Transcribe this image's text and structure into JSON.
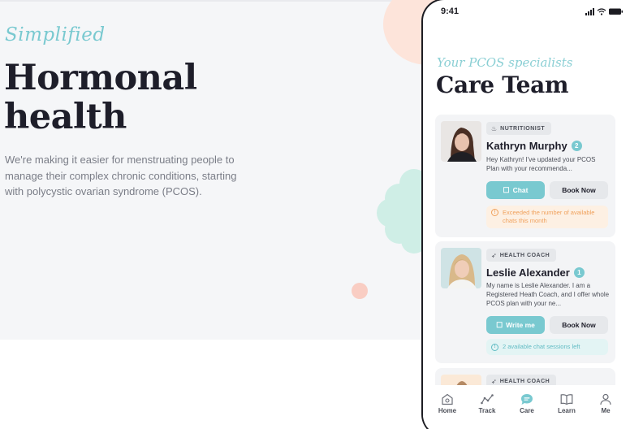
{
  "hero": {
    "eyebrow": "Simplified",
    "headline_line1": "Hormonal",
    "headline_line2": "health",
    "description": "We're making it easier for menstruating people to manage their complex chronic conditions, starting with polycystic ovarian syndrome (PCOS)."
  },
  "phone": {
    "status_time": "9:41",
    "subtitle": "Your PCOS specialists",
    "title": "Care Team",
    "cards": [
      {
        "role": "NUTRITIONIST",
        "role_icon": "pot-icon",
        "name": "Kathryn Murphy",
        "badge": "2",
        "message": "Hey Kathryn! I've updated your PCOS Plan with your recommenda...",
        "primary_button": "Chat",
        "secondary_button": "Book Now",
        "notice": "Exceeded the number of available chats this month"
      },
      {
        "role": "HEALTH COACH",
        "role_icon": "run-icon",
        "name": "Leslie Alexander",
        "badge": "1",
        "message": "My name is Leslie Alexander. I am a Registered Heath Coach, and I offer whole PCOS plan with your ne...",
        "primary_button": "Write me",
        "secondary_button": "Book Now",
        "notice": "2 available chat sessions left"
      },
      {
        "role": "HEALTH COACH",
        "role_icon": "run-icon"
      }
    ],
    "tabs": [
      {
        "label": "Home",
        "icon": "home-icon"
      },
      {
        "label": "Track",
        "icon": "track-icon"
      },
      {
        "label": "Care",
        "icon": "chat-icon"
      },
      {
        "label": "Learn",
        "icon": "book-icon"
      },
      {
        "label": "Me",
        "icon": "user-icon"
      }
    ]
  },
  "colors": {
    "accent": "#79c9d0",
    "warning": "#f0a15c",
    "text_dark": "#1e1e2a",
    "hero_bg": "#f5f6f8"
  }
}
